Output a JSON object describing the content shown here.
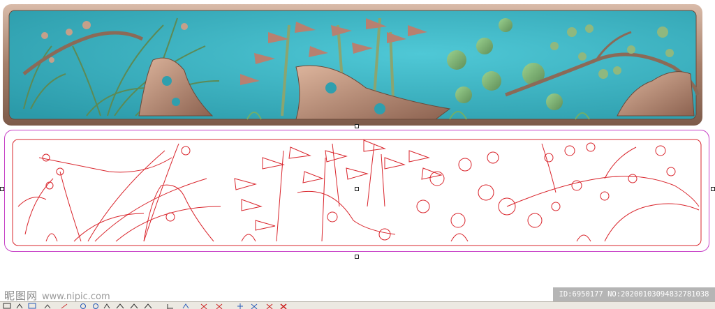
{
  "watermark": {
    "brand": "昵图网",
    "url": "www.nipic.com"
  },
  "image_id": {
    "text": "ID:6950177 NO:20200103094832781038"
  },
  "toolbar": {
    "tools": [
      {
        "name": "select-tool-icon"
      },
      {
        "name": "node-edit-tool-icon"
      },
      {
        "name": "shape-tool-icon"
      },
      {
        "name": "rotate-tool-icon"
      },
      {
        "name": "pen-tool-icon"
      },
      {
        "name": "zoom-in-tool-icon"
      },
      {
        "name": "zoom-out-tool-icon"
      },
      {
        "name": "polyline-tool-icon"
      },
      {
        "name": "offset-tool-icon"
      },
      {
        "name": "relief-tool-icon"
      },
      {
        "name": "fill-tool-icon"
      },
      {
        "name": "merge-tool-icon"
      },
      {
        "name": "smooth-tool-icon"
      },
      {
        "name": "delete-node-icon"
      },
      {
        "name": "add-node-icon"
      },
      {
        "name": "split-icon"
      },
      {
        "name": "close-vector-icon"
      },
      {
        "name": "delete-vector-icon"
      }
    ]
  },
  "colors": {
    "relief_teal": "#3fb6c6",
    "relief_frame": "#b79380",
    "vector_red": "#d9242b",
    "selection_magenta": "#c640c6"
  }
}
